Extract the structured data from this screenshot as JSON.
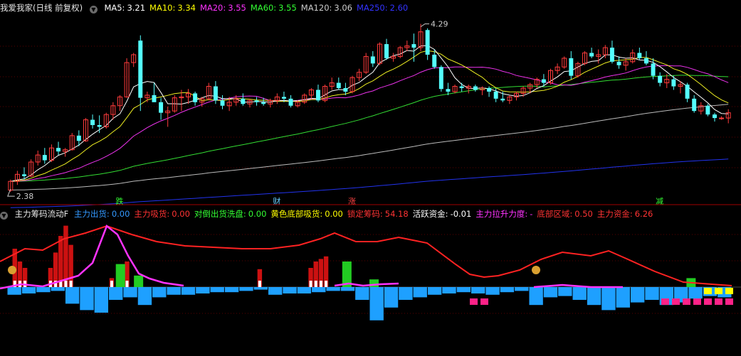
{
  "price_panel": {
    "title": "我爱我家(日线 前复权)",
    "ma": [
      {
        "label": "MA5:",
        "value": "3.21",
        "color": "#ffffff"
      },
      {
        "label": "MA10:",
        "value": "3.34",
        "color": "#ffff00"
      },
      {
        "label": "MA20:",
        "value": "3.55",
        "color": "#ff33ff"
      },
      {
        "label": "MA60:",
        "value": "3.55",
        "color": "#33ff33"
      },
      {
        "label": "MA120:",
        "value": "3.06",
        "color": "#cccccc"
      },
      {
        "label": "MA250:",
        "value": "2.60",
        "color": "#3333ff"
      }
    ],
    "high_label": "4.29",
    "low_label": "2.38",
    "event_marks": [
      {
        "text": "跌",
        "color": "#33ff33"
      },
      {
        "text": "财",
        "color": "#66ccff"
      },
      {
        "text": "涨",
        "color": "#ff4444"
      },
      {
        "text": "减",
        "color": "#33ff33"
      }
    ]
  },
  "indicator_panel": {
    "name": "主力筹码流动F",
    "fields": [
      {
        "label": "主力出货:",
        "value": "0.00",
        "color": "#3399ff"
      },
      {
        "label": "主力吸货:",
        "value": "0.00",
        "color": "#ff3333"
      },
      {
        "label": "对倒出货洗盘:",
        "value": "0.00",
        "color": "#33ff33"
      },
      {
        "label": "黄色底部吸货:",
        "value": "0.00",
        "color": "#ffff00"
      },
      {
        "label": "锁定筹码:",
        "value": "54.18",
        "color": "#ff3333"
      },
      {
        "label": "活跃资金:",
        "value": "-0.01",
        "color": "#ffffff"
      },
      {
        "label": "主力拉升力度:",
        "value": "-",
        "color": "#ff33ff"
      },
      {
        "label": "底部区域:",
        "value": "0.50",
        "color": "#ff3333"
      },
      {
        "label": "主力资金:",
        "value": "6.26",
        "color": "#ff3333"
      }
    ]
  },
  "chart_data": [
    {
      "type": "candlestick",
      "title": "我爱我家(日线 前复权)",
      "candles": [
        [
          2.4,
          2.52,
          2.38,
          2.5
        ],
        [
          2.5,
          2.62,
          2.46,
          2.58
        ],
        [
          2.58,
          2.66,
          2.52,
          2.56
        ],
        [
          2.56,
          2.75,
          2.55,
          2.72
        ],
        [
          2.72,
          2.85,
          2.68,
          2.8
        ],
        [
          2.8,
          2.88,
          2.7,
          2.74
        ],
        [
          2.74,
          2.92,
          2.72,
          2.88
        ],
        [
          2.88,
          2.95,
          2.8,
          2.84
        ],
        [
          2.84,
          2.88,
          2.78,
          2.86
        ],
        [
          2.86,
          3.05,
          2.85,
          3.02
        ],
        [
          3.02,
          3.08,
          2.9,
          2.96
        ],
        [
          2.96,
          3.22,
          2.95,
          3.2
        ],
        [
          3.2,
          3.26,
          3.1,
          3.14
        ],
        [
          3.14,
          3.25,
          3.05,
          3.12
        ],
        [
          3.12,
          3.28,
          3.1,
          3.26
        ],
        [
          3.26,
          3.4,
          3.2,
          3.36
        ],
        [
          3.36,
          3.48,
          3.3,
          3.46
        ],
        [
          3.46,
          3.9,
          3.45,
          3.85
        ],
        [
          3.85,
          3.96,
          3.8,
          3.94
        ],
        [
          4.1,
          4.16,
          3.3,
          3.45
        ],
        [
          3.45,
          3.52,
          3.4,
          3.48
        ],
        [
          3.48,
          3.62,
          3.42,
          3.4
        ],
        [
          3.4,
          3.45,
          3.2,
          3.28
        ],
        [
          3.28,
          3.35,
          3.12,
          3.3
        ],
        [
          3.3,
          3.48,
          3.28,
          3.45
        ],
        [
          3.45,
          3.54,
          3.3,
          3.46
        ],
        [
          3.46,
          3.55,
          3.38,
          3.5
        ],
        [
          3.5,
          3.52,
          3.36,
          3.4
        ],
        [
          3.4,
          3.46,
          3.35,
          3.44
        ],
        [
          3.44,
          3.62,
          3.42,
          3.58
        ],
        [
          3.58,
          3.64,
          3.38,
          3.42
        ],
        [
          3.42,
          3.48,
          3.32,
          3.36
        ],
        [
          3.36,
          3.46,
          3.3,
          3.4
        ],
        [
          3.4,
          3.48,
          3.36,
          3.44
        ],
        [
          3.44,
          3.5,
          3.36,
          3.38
        ],
        [
          3.38,
          3.44,
          3.34,
          3.42
        ],
        [
          3.42,
          3.46,
          3.36,
          3.4
        ],
        [
          3.4,
          3.45,
          3.36,
          3.38
        ],
        [
          3.38,
          3.44,
          3.34,
          3.42
        ],
        [
          3.42,
          3.5,
          3.38,
          3.46
        ],
        [
          3.46,
          3.52,
          3.4,
          3.44
        ],
        [
          3.44,
          3.48,
          3.34,
          3.36
        ],
        [
          3.36,
          3.42,
          3.34,
          3.4
        ],
        [
          3.4,
          3.5,
          3.38,
          3.48
        ],
        [
          3.48,
          3.56,
          3.44,
          3.54
        ],
        [
          3.54,
          3.6,
          3.4,
          3.42
        ],
        [
          3.42,
          3.6,
          3.4,
          3.58
        ],
        [
          3.58,
          3.68,
          3.54,
          3.62
        ],
        [
          3.62,
          3.68,
          3.54,
          3.56
        ],
        [
          3.56,
          3.62,
          3.48,
          3.52
        ],
        [
          3.52,
          3.7,
          3.5,
          3.68
        ],
        [
          3.68,
          3.78,
          3.64,
          3.74
        ],
        [
          3.74,
          3.96,
          3.72,
          3.92
        ],
        [
          3.92,
          3.98,
          3.8,
          3.84
        ],
        [
          3.84,
          4.08,
          3.82,
          4.06
        ],
        [
          4.06,
          4.12,
          3.88,
          3.9
        ],
        [
          3.9,
          3.96,
          3.86,
          3.92
        ],
        [
          3.92,
          4.04,
          3.9,
          4.02
        ],
        [
          4.02,
          4.1,
          3.98,
          4.04
        ],
        [
          4.06,
          4.18,
          3.86,
          4.02
        ],
        [
          4.02,
          4.29,
          3.98,
          4.2
        ],
        [
          4.22,
          4.24,
          3.88,
          3.94
        ],
        [
          3.94,
          4.0,
          3.78,
          3.8
        ],
        [
          3.8,
          3.82,
          3.52,
          3.55
        ],
        [
          3.55,
          3.62,
          3.48,
          3.52
        ],
        [
          3.52,
          3.6,
          3.5,
          3.58
        ],
        [
          3.58,
          3.62,
          3.52,
          3.56
        ],
        [
          3.56,
          3.6,
          3.5,
          3.58
        ],
        [
          3.58,
          3.6,
          3.52,
          3.54
        ],
        [
          3.54,
          3.58,
          3.48,
          3.56
        ],
        [
          3.56,
          3.58,
          3.46,
          3.52
        ],
        [
          3.52,
          3.56,
          3.4,
          3.44
        ],
        [
          3.44,
          3.52,
          3.4,
          3.42
        ],
        [
          3.42,
          3.48,
          3.38,
          3.46
        ],
        [
          3.46,
          3.52,
          3.42,
          3.5
        ],
        [
          3.5,
          3.58,
          3.46,
          3.56
        ],
        [
          3.56,
          3.62,
          3.5,
          3.6
        ],
        [
          3.6,
          3.68,
          3.56,
          3.66
        ],
        [
          3.66,
          3.72,
          3.58,
          3.62
        ],
        [
          3.62,
          3.78,
          3.6,
          3.76
        ],
        [
          3.76,
          3.84,
          3.72,
          3.8
        ],
        [
          3.8,
          3.92,
          3.78,
          3.9
        ],
        [
          3.9,
          3.98,
          3.66,
          3.7
        ],
        [
          3.7,
          3.86,
          3.68,
          3.84
        ],
        [
          3.84,
          3.98,
          3.82,
          3.96
        ],
        [
          3.96,
          4.02,
          3.9,
          3.92
        ],
        [
          3.92,
          4.0,
          3.84,
          3.94
        ],
        [
          3.94,
          4.05,
          3.9,
          4.02
        ],
        [
          4.02,
          4.1,
          3.84,
          3.86
        ],
        [
          3.86,
          3.92,
          3.78,
          3.82
        ],
        [
          3.82,
          3.9,
          3.76,
          3.86
        ],
        [
          3.86,
          4.0,
          3.84,
          3.96
        ],
        [
          3.96,
          4.02,
          3.88,
          3.9
        ],
        [
          3.9,
          3.98,
          3.82,
          3.84
        ],
        [
          3.84,
          3.9,
          3.66,
          3.7
        ],
        [
          3.7,
          3.74,
          3.58,
          3.62
        ],
        [
          3.62,
          3.72,
          3.56,
          3.66
        ],
        [
          3.66,
          3.7,
          3.54,
          3.58
        ],
        [
          3.58,
          3.64,
          3.5,
          3.6
        ],
        [
          3.6,
          3.62,
          3.4,
          3.44
        ],
        [
          3.44,
          3.48,
          3.28,
          3.3
        ],
        [
          3.3,
          3.4,
          3.26,
          3.36
        ],
        [
          3.36,
          3.38,
          3.24,
          3.26
        ],
        [
          3.26,
          3.28,
          3.18,
          3.22
        ],
        [
          3.22,
          3.24,
          3.2,
          3.22
        ],
        [
          3.22,
          3.32,
          3.16,
          3.28
        ]
      ],
      "ma_values": {
        "MA5": 3.21,
        "MA10": 3.34,
        "MA20": 3.55,
        "MA60": 3.55,
        "MA120": 3.06,
        "MA250": 2.6
      },
      "ylim": [
        2.3,
        4.4
      ],
      "annotations": [
        "4.29",
        "2.38"
      ]
    },
    {
      "type": "bar",
      "title": "主力筹码流动F",
      "series": [
        {
          "name": "主力吸货",
          "color": "#dd1111",
          "values": [
            0,
            3.0,
            2.0,
            1.5,
            0,
            0,
            0,
            0,
            1.5,
            2.7,
            4.0,
            4.8,
            3.3,
            0,
            0,
            0,
            0,
            0,
            0,
            0,
            0.7,
            0,
            0,
            2.0,
            0,
            0,
            0,
            0,
            0,
            0,
            0,
            0,
            0,
            0,
            0,
            0,
            0,
            0,
            0,
            0,
            0,
            0,
            0,
            0,
            0,
            0,
            0,
            0,
            0,
            1.4,
            0,
            0,
            0,
            0,
            0,
            0,
            0,
            0,
            0,
            1.5,
            2.0,
            2.2,
            2.4,
            0,
            0,
            0,
            0,
            0,
            0,
            0,
            0,
            0,
            0,
            0,
            0,
            0,
            0,
            0,
            0,
            0,
            0,
            0,
            0,
            0,
            0,
            0,
            0,
            0,
            0,
            0,
            0,
            0,
            0,
            0,
            0,
            0,
            0,
            0,
            0,
            0,
            0,
            0,
            0,
            0,
            0,
            0,
            0,
            0,
            0,
            0,
            0,
            0,
            0,
            0,
            0,
            0,
            0,
            0,
            0,
            0,
            0,
            0,
            0,
            0,
            0,
            0,
            0,
            0,
            0,
            0,
            0,
            0,
            0,
            0,
            0,
            0,
            0,
            0,
            0,
            0,
            0,
            0
          ]
        },
        {
          "name": "主力出货",
          "color": "#1ea0ff",
          "values": [
            -0.6,
            -0.5,
            -0.4,
            -0.3,
            -1.3,
            -1.8,
            -2.0,
            -1.0,
            -0.8,
            -1.4,
            -0.8,
            -0.6,
            -0.6,
            -0.5,
            -0.4,
            -0.4,
            -0.3,
            -0.2,
            -0.6,
            -0.5,
            -0.5,
            -0.4,
            -0.3,
            -0.3,
            -1.0,
            -2.6,
            -1.6,
            -1.0,
            -0.8,
            -0.6,
            -0.5,
            -0.4,
            -0.5,
            -0.6,
            -0.4,
            -0.3,
            -1.4,
            -0.8,
            -0.7,
            -1.0,
            -1.4,
            -1.8,
            -1.6,
            -1.2,
            -1.0,
            -1.4,
            -1.2,
            -0.9,
            -0.7,
            -0.8
          ]
        }
      ],
      "lines": [
        {
          "name": "锁定筹码",
          "color": "#ff2222"
        },
        {
          "name": "主力拉升力度",
          "color": "#ff33ff"
        }
      ],
      "values": {
        "主力出货": 0.0,
        "主力吸货": 0.0,
        "对倒出货洗盘": 0.0,
        "黄色底部吸货": 0.0,
        "锁定筹码": 54.18,
        "活跃资金": -0.01,
        "底部区域": 0.5,
        "主力资金": 6.26
      }
    }
  ]
}
